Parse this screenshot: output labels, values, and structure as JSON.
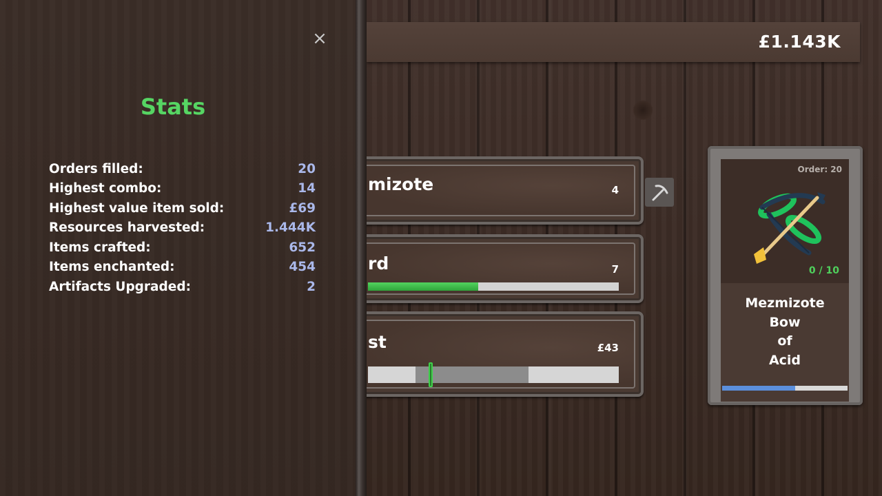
{
  "header": {
    "money": "£1.143K"
  },
  "tasks": [
    {
      "title": "mizote",
      "value": "4"
    },
    {
      "title": "rd",
      "value": "7",
      "progress": 0.44
    },
    {
      "title": "st",
      "value": "£43",
      "range_start": 0.19,
      "range_end": 0.64,
      "marker": 0.25
    }
  ],
  "order": {
    "label": "Order: 20",
    "count": "0 / 10",
    "name_lines": [
      "Mezmizote",
      "Bow",
      "of",
      "Acid"
    ],
    "progress": 0.58,
    "icon": "bow-arrow-icon"
  },
  "stats": {
    "title": "Stats",
    "close_icon": "×",
    "rows": [
      {
        "label": "Orders filled:",
        "value": "20"
      },
      {
        "label": "Highest combo:",
        "value": "14"
      },
      {
        "label": "Highest value item sold:",
        "value": "£69"
      },
      {
        "label": "Resources harvested:",
        "value": "1.444K"
      },
      {
        "label": "Items crafted:",
        "value": "652"
      },
      {
        "label": "Items enchanted:",
        "value": "454"
      },
      {
        "label": "Artifacts Upgraded:",
        "value": "2"
      }
    ]
  },
  "colors": {
    "accent_green": "#56d563",
    "stat_value": "#aab8ea",
    "progress_blue": "#5b8fdc"
  }
}
